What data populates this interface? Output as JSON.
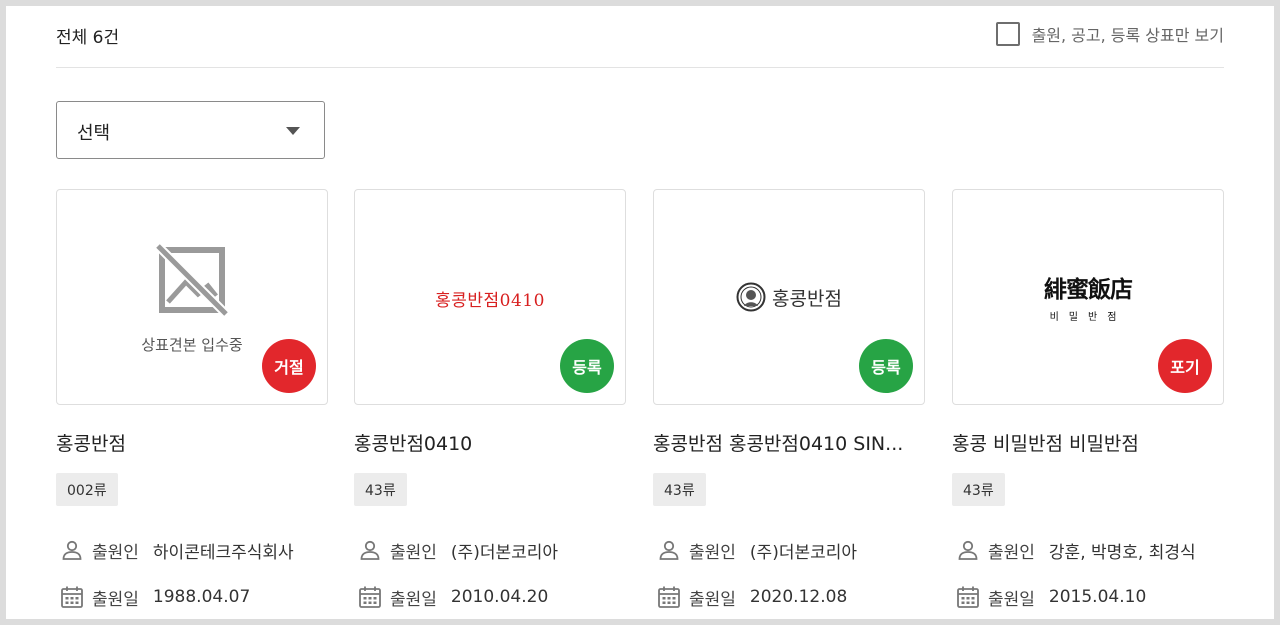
{
  "header": {
    "total_label": "전체 6건",
    "filter_label": "출원, 공고, 등록 상표만 보기",
    "filter_checked": false
  },
  "sort_select": {
    "value": "선택"
  },
  "labels": {
    "applicant": "출원인",
    "filing_date": "출원일"
  },
  "colors": {
    "status_red": "#e2272c",
    "status_green": "#27a445",
    "logo_red": "#d82020"
  },
  "cards": [
    {
      "title": "홍콩반점",
      "class": "002류",
      "status": "거절",
      "status_color": "red",
      "image": {
        "type": "placeholder",
        "icon": "no-image-icon",
        "text": "상표견본 입수중"
      },
      "applicant": "하이콘테크주식회사",
      "filing_date": "1988.04.07"
    },
    {
      "title": "홍콩반점0410",
      "class": "43류",
      "status": "등록",
      "status_color": "green",
      "image": {
        "type": "logo",
        "text": "홍콩반점0410"
      },
      "applicant": "(주)더본코리아",
      "filing_date": "2010.04.20"
    },
    {
      "title": "홍콩반점 홍콩반점0410 SIN...",
      "class": "43류",
      "status": "등록",
      "status_color": "green",
      "image": {
        "type": "logo",
        "icon": "chef-face-seal-icon",
        "text": "홍콩반점"
      },
      "applicant": "(주)더본코리아",
      "filing_date": "2020.12.08"
    },
    {
      "title": "홍콩 비밀반점 비밀반점",
      "class": "43류",
      "status": "포기",
      "status_color": "red",
      "image": {
        "type": "logo",
        "text": "緋蜜飯店",
        "subtext": "비밀반점"
      },
      "applicant": "강훈, 박명호, 최경식",
      "filing_date": "2015.04.10"
    }
  ]
}
